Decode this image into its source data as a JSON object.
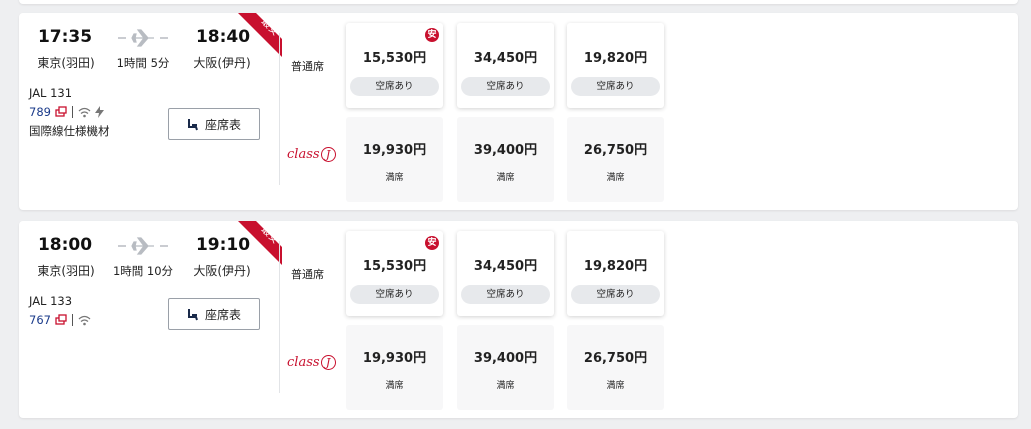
{
  "flights": [
    {
      "dep_time": "17:35",
      "arr_time": "18:40",
      "dep_airport": "東京(羽田)",
      "arr_airport": "大阪(伊丹)",
      "duration": "1時間 5分",
      "badge": "最安",
      "flight_no": "JAL  131",
      "aircraft": "789",
      "amenities": [
        "seat-power-icon",
        "wifi-icon",
        "power-icon"
      ],
      "note": "国際線仕様機材",
      "seat_map_label": "座席表",
      "cabins": [
        {
          "label": "普通席",
          "fares": [
            {
              "price": "15,530円",
              "status": "空席あり",
              "badge": "安"
            },
            {
              "price": "34,450円",
              "status": "空席あり"
            },
            {
              "price": "19,820円",
              "status": "空席あり"
            }
          ]
        },
        {
          "label_text": "class",
          "label_mark": "J",
          "fares": [
            {
              "price": "19,930円",
              "status": "満席"
            },
            {
              "price": "39,400円",
              "status": "満席"
            },
            {
              "price": "26,750円",
              "status": "満席"
            }
          ]
        }
      ]
    },
    {
      "dep_time": "18:00",
      "arr_time": "19:10",
      "dep_airport": "東京(羽田)",
      "arr_airport": "大阪(伊丹)",
      "duration": "1時間 10分",
      "badge": "最安",
      "flight_no": "JAL  133",
      "aircraft": "767",
      "amenities": [
        "seat-power-icon",
        "wifi-icon"
      ],
      "note": "",
      "seat_map_label": "座席表",
      "cabins": [
        {
          "label": "普通席",
          "fares": [
            {
              "price": "15,530円",
              "status": "空席あり",
              "badge": "安"
            },
            {
              "price": "34,450円",
              "status": "空席あり"
            },
            {
              "price": "19,820円",
              "status": "空席あり"
            }
          ]
        },
        {
          "label_text": "class",
          "label_mark": "J",
          "fares": [
            {
              "price": "19,930円",
              "status": "満席"
            },
            {
              "price": "39,400円",
              "status": "満席"
            },
            {
              "price": "26,750円",
              "status": "満席"
            }
          ]
        }
      ]
    }
  ],
  "colors": {
    "accent": "#c8102e",
    "aircraft_link": "#1a3a8a",
    "background": "#eeeff1"
  }
}
